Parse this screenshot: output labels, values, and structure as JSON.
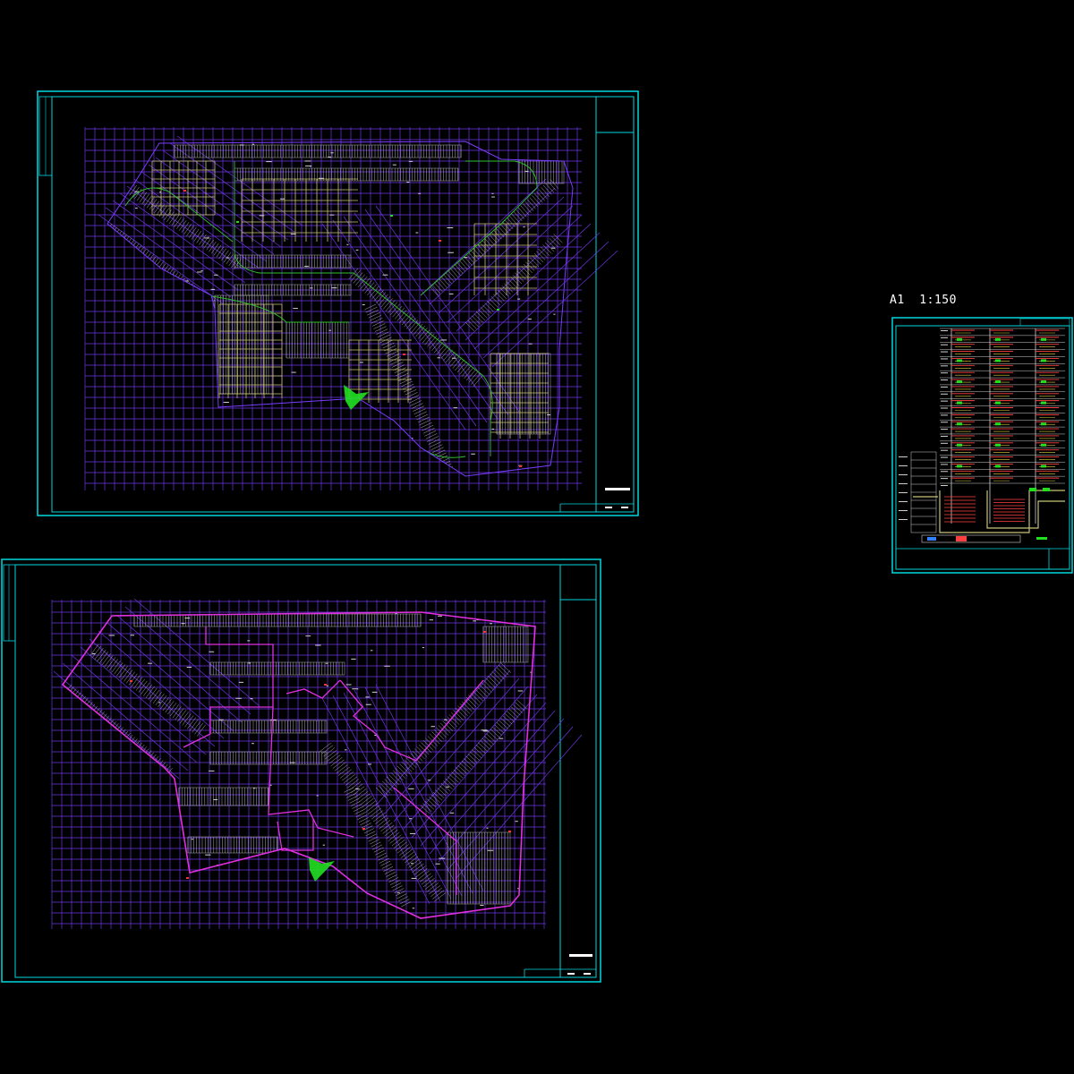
{
  "drawing": {
    "scale_label": "A1  1:150",
    "colors": {
      "background": "#000000",
      "frame": "#00d8e0",
      "grid": "#7a3cff",
      "boundary": "#e030e0",
      "parking": "#b0b0b0",
      "road": "#30c030",
      "tan": "#c8c27a",
      "accent_red": "#ff3030",
      "riser_red": "#ff4040",
      "riser_yellow": "#e0d040",
      "riser_green": "#20e020"
    }
  }
}
